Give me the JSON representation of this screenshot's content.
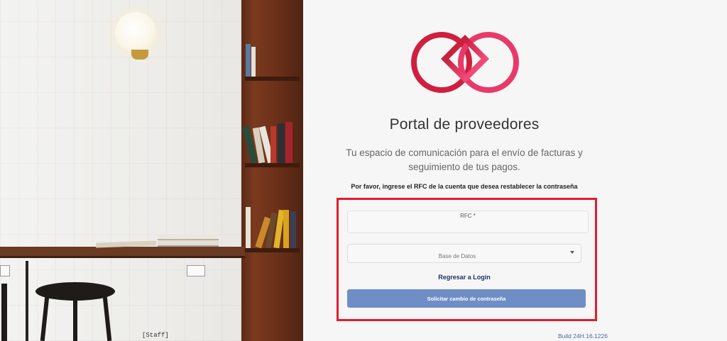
{
  "photo": {
    "caption": "[Staff]"
  },
  "brand": {
    "logo_icon": "interlocking-rings-logo",
    "primary_color": "#cf1f3f",
    "secondary_color": "#e83a6a"
  },
  "header": {
    "title": "Portal de proveedores",
    "subtitle": "Tu espacio de comunicación para el envío de facturas y seguimiento de tus pagos."
  },
  "form": {
    "instruction": "Por favor, ingrese el RFC de la cuenta que desea restablecer la contraseña",
    "rfc_label": "RFC *",
    "rfc_value": "",
    "database_select": {
      "selected": "Base de Datos"
    },
    "back_link": "Regresar a Login",
    "submit_label": "Solicitar cambio de contraseña",
    "submit_color": "#6f8ec6",
    "highlight_color": "#e11d2e"
  },
  "footer": {
    "build": "Build 24H.16.1226"
  }
}
